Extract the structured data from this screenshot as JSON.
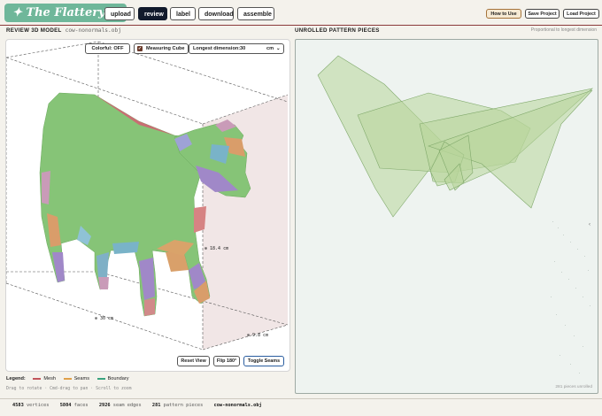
{
  "header": {
    "logo": "✦ The Flattery ✦",
    "nav": [
      {
        "label": "upload"
      },
      {
        "label": "review"
      },
      {
        "label": "label"
      },
      {
        "label": "download"
      },
      {
        "label": "assemble"
      }
    ],
    "active_tab": "review",
    "how_to_use": "How to Use",
    "save_project": "Save Project",
    "load_project": "Load Project"
  },
  "left_panel": {
    "title": "REVIEW 3D MODEL",
    "filename": "cow-nonormals.obj",
    "colorful_toggle": "Colorful: OFF",
    "measuring_cube_label": "Measuring Cube",
    "measuring_cube_checked": true,
    "longest_dimension_label": "Longest dimension:",
    "longest_dimension_value": "30",
    "unit": "cm",
    "dims": {
      "height": "⊕ 18.4 cm",
      "length": "⊕ 30 cm",
      "depth": "⊕ 9.8 cm"
    },
    "buttons": {
      "reset_view": "Reset View",
      "flip": "Flip 180°",
      "toggle_seams": "Toggle Seams"
    }
  },
  "right_panel": {
    "title": "UNROLLED PATTERN PIECES",
    "note": "Proportional to longest dimension",
    "pieces_note": "281 pieces unrolled",
    "side_marker": "‹"
  },
  "legend": {
    "label": "Legend:",
    "items": [
      {
        "name": "Mesh",
        "color": "#c2555b"
      },
      {
        "name": "Seams",
        "color": "#e0a04a"
      },
      {
        "name": "Boundary",
        "color": "#3aa37e"
      }
    ]
  },
  "hint": "Drag to rotate · Cmd-drag to pan · Scroll to zoom",
  "stats": {
    "vertices_value": "4583",
    "vertices_label": "vertices",
    "faces_value": "5804",
    "faces_label": "faces",
    "seams_value": "2926",
    "seams_label": "seam edges",
    "pieces_value": "281",
    "pieces_label": "pattern pieces",
    "filename": "cow-nonormals.obj"
  },
  "colors": {
    "accent": "#6fb79a",
    "active_tab": "#111a2c",
    "rule": "#8b3a3a",
    "piece_fill": "#b8d69a",
    "mesh_green": "#86c477"
  }
}
